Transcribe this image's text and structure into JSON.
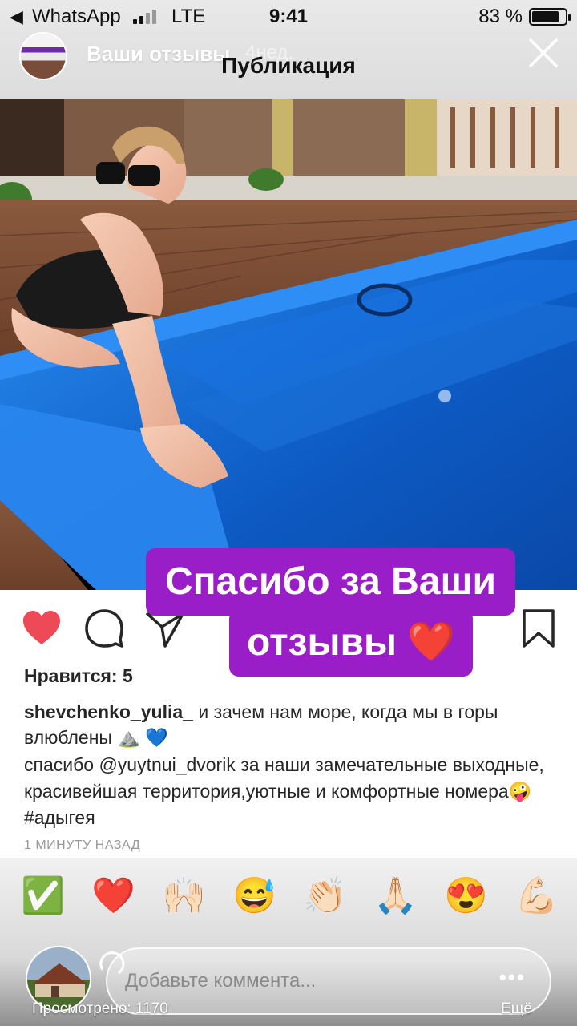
{
  "status_bar": {
    "back_icon": "back-chevron-icon",
    "app": "WhatsApp",
    "network": "LTE",
    "time": "9:41",
    "battery_percent_text": "83 %",
    "battery_level": 0.83
  },
  "story_header": {
    "title": "Ваши отзывы",
    "age": "4нед.",
    "page_heading": "Публикация",
    "close_icon": "close-icon"
  },
  "post": {
    "likes_text": "Нравится: 5",
    "username": "shevchenko_yulia_",
    "caption_text": "и зачем нам море, когда мы в горы влюблены ⛰️ 💙",
    "comment_prefix": "спасибо",
    "mention": "@yuytnui_dvorik",
    "comment_text": "за наши замечательные выходные, красивейшая территория,уютные и комфортные номера🤪",
    "hashtag": "#адыгея",
    "time_ago": "1 МИНУТУ НАЗАД",
    "liked": true
  },
  "sticker": {
    "line1": "Спасибо за Ваши",
    "line2": "отзывы ❤️",
    "color": "#9a1ec8"
  },
  "quick_reactions": [
    "✅",
    "❤️",
    "🙌🏻",
    "😅",
    "👏🏻",
    "🙏🏻",
    "😍",
    "💪🏻"
  ],
  "reply": {
    "placeholder": "Добавьте коммента...",
    "more_icon": "more-dots-icon"
  },
  "footer": {
    "views": "Просмотрено: 1170",
    "more_label": "Ещё"
  },
  "colors": {
    "heart": "#ed4956",
    "mention": "#1c3f72",
    "pool": "#1a6fd6"
  }
}
